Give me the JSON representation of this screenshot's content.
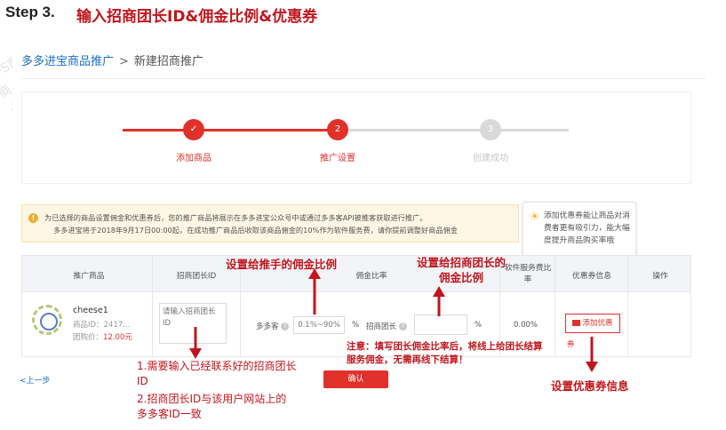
{
  "header": {
    "step_label": "Step 3.",
    "step_title": "输入招商团长ID&佣金比例&优惠券"
  },
  "watermark": {
    "lines": [
      "CPS商户",
      "商",
      "必"
    ]
  },
  "breadcrumb": {
    "parent": "多多进宝商品推广",
    "separator": ">",
    "current": "新建招商推广"
  },
  "steps": {
    "items": [
      {
        "label": "添加商品",
        "marker": "✓",
        "state": "done"
      },
      {
        "label": "推广设置",
        "marker": "2",
        "state": "active"
      },
      {
        "label": "创建成功",
        "marker": "3",
        "state": "pending"
      }
    ],
    "colors": {
      "done": "#e0312b",
      "pending": "#d9d9d9"
    }
  },
  "notice": {
    "icon": "warning-icon",
    "line1": "为已选择的商品设置佣金和优惠券后，您的推广商品将展示在多多进宝公众号中或通过多多客API被推客获取进行推广。",
    "line2": "多多进宝将于2018年9月17日00:00起，在成功推广商品后收取该商品佣金的10%作为软件服务费，请你提前调整好商品佣金"
  },
  "tooltip": {
    "icon": "lightbulb-icon",
    "text": "添加优惠券能让商品对消费者更有吸引力，能大幅度提升商品购买率哦"
  },
  "table": {
    "headers": {
      "product": "推广商品",
      "leader_id": "招商团长ID",
      "commission": "佣金比率",
      "service_fee": "软件服务费比率",
      "coupon": "优惠券信息",
      "ops": "操作"
    },
    "row": {
      "name": "cheese1",
      "id_label": "商品ID：2417...",
      "price_label": "团购价：",
      "price": "12.00元",
      "leader_placeholder": "请输入招商团长ID",
      "ddk_label": "多多客",
      "rate_placeholder": "0.1%~90%",
      "percent": "%",
      "leader_rate_label": "招商团长",
      "service_rate": "0.00%",
      "coupon_button": "添加优惠",
      "coupon_wrap": "券"
    }
  },
  "footer": {
    "prev": "<上一步",
    "confirm": "确认"
  },
  "annotations": {
    "pusher_rate": "设置给推手的佣金比例",
    "leader_rate": "设置给招商团长的佣金比例",
    "note_key": "注意：",
    "note_text": "填写团长佣金比率后，将线上给团长结算服务佣金，无需再线下结算！",
    "coupon": "设置优惠券信息",
    "req1": "1.需要输入已经联系好的招商团长ID",
    "req2": "2.招商团长ID与该用户网站上的多多客ID一致"
  },
  "colors": {
    "accent_red": "#c0161d",
    "brand_red": "#e0312b",
    "link_blue": "#1a6fc9",
    "notice_bg": "#fdf6e4"
  }
}
